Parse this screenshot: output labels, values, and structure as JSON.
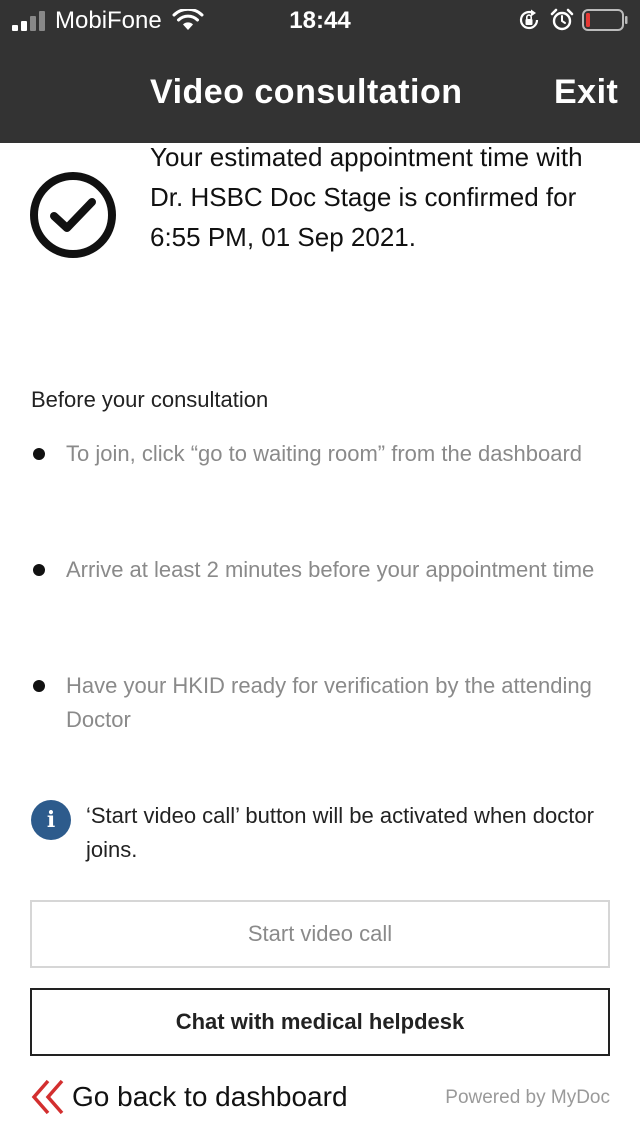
{
  "status_bar": {
    "carrier": "MobiFone",
    "time": "18:44",
    "battery_color": "#e53935"
  },
  "header": {
    "title": "Video consultation",
    "exit_label": "Exit",
    "background": "#333333"
  },
  "confirmation": {
    "icon": "check-circle-icon",
    "message": "Your estimated appointment time with Dr. HSBC Doc Stage is confirmed for 6:55 PM, 01 Sep 2021."
  },
  "before": {
    "heading": "Before your consultation",
    "items": [
      "To join, click “go to waiting room” from the dashboard",
      "Arrive at least 2 minutes before your appointment time",
      "Have your HKID ready for verification by the attending Doctor"
    ]
  },
  "info": {
    "icon_glyph": "i",
    "icon_color": "#2d5b8c",
    "message": "‘Start video call’ button will be activated when doctor joins."
  },
  "actions": {
    "start_video_label": "Start video call",
    "chat_label": "Chat with medical helpdesk"
  },
  "footer": {
    "back_label": "Go back to dashboard",
    "back_icon_color": "#d32f2f",
    "powered_by": "Powered by MyDoc"
  }
}
